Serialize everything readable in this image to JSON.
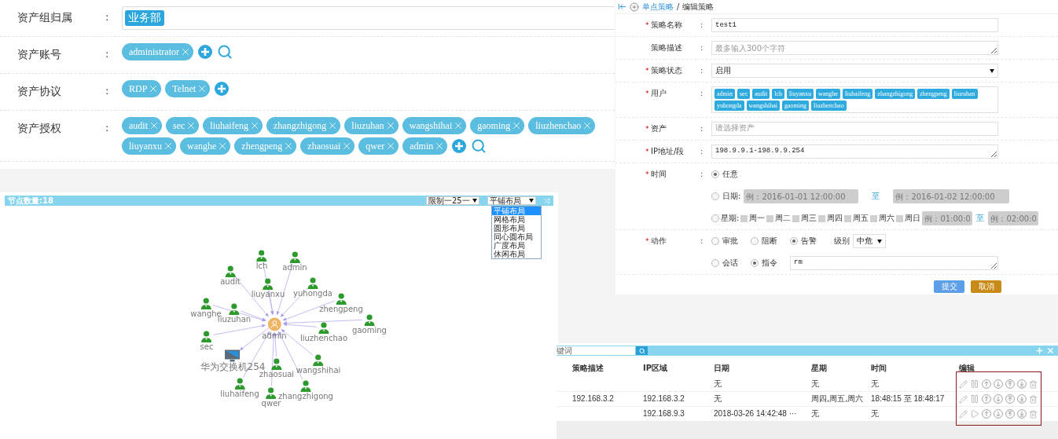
{
  "asset_panel": {
    "rows": [
      {
        "label": "资产组归属",
        "separator": ":",
        "kind": "group",
        "tags": [
          "业务部"
        ]
      },
      {
        "label": "资产账号",
        "separator": ":",
        "kind": "chips",
        "tags": [
          "administrator"
        ],
        "add": true,
        "search": true
      },
      {
        "label": "资产协议",
        "separator": ":",
        "kind": "chips",
        "tags": [
          "RDP",
          "Telnet"
        ],
        "add": true,
        "search": false
      },
      {
        "label": "资产授权",
        "separator": ":",
        "kind": "chips",
        "tags": [
          "audit",
          "sec",
          "liuhaifeng",
          "zhangzhigong",
          "liuzuhan",
          "wangshihai",
          "gaoming",
          "liuzhenchao",
          "liuyanxu",
          "wanghe",
          "zhengpeng",
          "zhaosuai",
          "qwer",
          "admin"
        ],
        "add": true,
        "search": true
      }
    ]
  },
  "graph": {
    "node_count": "节点数量:18",
    "limit_select": "限制一25一",
    "layout_select": "平铺布局",
    "layout_options": [
      {
        "label": "平铺布局",
        "selected": true
      },
      {
        "label": "网格布局",
        "selected": false
      },
      {
        "label": "圆形布局",
        "selected": false
      },
      {
        "label": "同心圆布局",
        "selected": false
      },
      {
        "label": "广度布局",
        "selected": false
      },
      {
        "label": "休闲布局",
        "selected": false
      }
    ],
    "nodes": [
      {
        "label": "admin",
        "kind": "center"
      },
      {
        "label": "lch",
        "kind": "user"
      },
      {
        "label": "admin",
        "kind": "user"
      },
      {
        "label": "audit",
        "kind": "user"
      },
      {
        "label": "liuyanxu",
        "kind": "user"
      },
      {
        "label": "yuhongda",
        "kind": "user"
      },
      {
        "label": "zhengpeng",
        "kind": "user"
      },
      {
        "label": "wanghe",
        "kind": "user"
      },
      {
        "label": "liuzuhan",
        "kind": "user"
      },
      {
        "label": "liuzhenchao",
        "kind": "user"
      },
      {
        "label": "gaoming",
        "kind": "user"
      },
      {
        "label": "sec",
        "kind": "user"
      },
      {
        "label": "华为交换机254",
        "kind": "device"
      },
      {
        "label": "zhaosuai",
        "kind": "user"
      },
      {
        "label": "wangshihai",
        "kind": "user"
      },
      {
        "label": "liuhaifeng",
        "kind": "user"
      },
      {
        "label": "qwer",
        "kind": "user"
      },
      {
        "label": "zhangzhigong",
        "kind": "user"
      }
    ]
  },
  "form": {
    "breadcrumb": {
      "parent": "单点策略",
      "current": "/ 编辑策略"
    },
    "fields": [
      {
        "kind": "input",
        "mark": "*",
        "label": "策略名称",
        "separator": ":",
        "value": "test1"
      },
      {
        "kind": "textarea",
        "label": "策略描述",
        "separator": ":",
        "placeholder": "最多输入300个字符"
      },
      {
        "kind": "select",
        "mark": "*",
        "label": "策略状态",
        "separator": ":",
        "value": "启用"
      },
      {
        "kind": "tags",
        "mark": "*",
        "label": "用户",
        "separator": ":",
        "tags": [
          "admin",
          "sec",
          "audit",
          "lch",
          "liuyanxu",
          "wanghe",
          "liuhaifeng",
          "zhangzhigong",
          "zhengpeng",
          "liuruhan",
          "yuhongda",
          "wangshihai",
          "gaoming",
          "liuzhenchao"
        ]
      },
      {
        "kind": "input",
        "mark": "*",
        "label": "资产",
        "separator": ":",
        "placeholder": "请选择资产"
      },
      {
        "kind": "textarea",
        "mark": "*",
        "label": "IP地址/段",
        "separator": ":",
        "value": "198.9.9.1-198.9.9.254"
      },
      {
        "kind": "time",
        "mark": "*",
        "label": "时间",
        "separator": ":",
        "options": [
          {
            "kind": "plain",
            "label": "任意",
            "selected": true
          },
          {
            "kind": "date",
            "label": "日期:",
            "selected": false,
            "from_placeholder": "例：2016-01-01 12:00:00",
            "to": "至",
            "to_placeholder": "例：2016-01-02 12:00:00"
          },
          {
            "kind": "week",
            "label": "星期:",
            "selected": false,
            "days": [
              {
                "label": "周一",
                "checked": false
              },
              {
                "label": "周二",
                "checked": false
              },
              {
                "label": "周三",
                "checked": false
              },
              {
                "label": "周四",
                "checked": false
              },
              {
                "label": "周五",
                "checked": false
              },
              {
                "label": "周六",
                "checked": false
              },
              {
                "label": "周日",
                "checked": false
              }
            ],
            "from_placeholder": "例：01:00:0",
            "to": "至",
            "to_placeholder": "例：02:00:0"
          }
        ]
      },
      {
        "kind": "action",
        "mark": "*",
        "label": "动作",
        "separator": ":",
        "actions": [
          {
            "label": "审批",
            "selected": false
          },
          {
            "label": "阻断",
            "selected": false
          },
          {
            "label": "告警",
            "selected": true
          }
        ],
        "level_label": "级别",
        "level_value": "中危",
        "modes": [
          {
            "label": "会话",
            "selected": false
          },
          {
            "label": "指令",
            "selected": true
          }
        ],
        "command": "rm"
      }
    ],
    "buttons": [
      {
        "label": "提交",
        "kind": "primary"
      },
      {
        "label": "取消",
        "kind": "cancel"
      }
    ]
  },
  "table": {
    "search_placeholder": "键词",
    "columns": [
      "策略描述",
      "IP区域",
      "日期",
      "星期",
      "时间",
      "编辑"
    ],
    "actions_highlighted": true,
    "rows": [
      {
        "cells": [
          "",
          "",
          "无",
          "无",
          "无"
        ],
        "running": true
      },
      {
        "cells": [
          "192.168.3.2",
          "192.168.3.2",
          "无",
          "周四,周五,周六",
          "18:48:15 至 18:48:17"
        ],
        "running": true
      },
      {
        "cells": [
          "",
          "192.168.9.3",
          "2018-03-26 14:42:48 ···",
          "无",
          "无"
        ],
        "running": false
      }
    ]
  }
}
